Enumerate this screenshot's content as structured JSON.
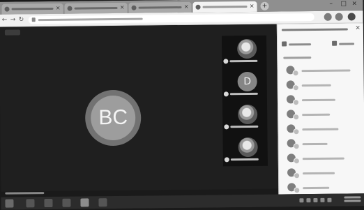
{
  "browser": {
    "tabs": [
      {
        "title": "",
        "active": false
      },
      {
        "title": "",
        "active": false
      },
      {
        "title": "",
        "active": false
      },
      {
        "title": "",
        "active": true
      }
    ],
    "url": "",
    "icons": {
      "back": "back-arrow-icon",
      "forward": "forward-arrow-icon",
      "reload": "reload-icon"
    }
  },
  "meeting": {
    "speaker_initials": "BC",
    "presenter_name": "",
    "tiles": [
      {
        "initials": "",
        "name": ""
      },
      {
        "initials": "D",
        "name": ""
      },
      {
        "initials": "",
        "name": ""
      },
      {
        "initials": "",
        "name": ""
      }
    ]
  },
  "panel": {
    "title": "",
    "add_people_label": "",
    "share_label": "",
    "section_label": "",
    "participants": [
      {
        "name": ""
      },
      {
        "name": ""
      },
      {
        "name": ""
      },
      {
        "name": ""
      },
      {
        "name": ""
      },
      {
        "name": ""
      },
      {
        "name": ""
      },
      {
        "name": ""
      },
      {
        "name": ""
      }
    ]
  },
  "colors": {
    "stage_bg": "#1f1f1f",
    "panel_bg": "#f7f7f7",
    "speaker_ring": "#727272",
    "taskbar_bg": "#2c2c2c"
  }
}
